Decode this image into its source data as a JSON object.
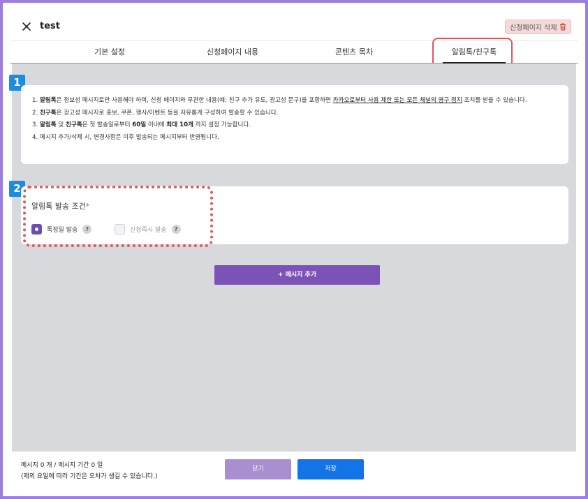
{
  "header": {
    "title": "test",
    "delete_label": "신청페이지 삭제"
  },
  "tabs": [
    {
      "label": "기본 설정"
    },
    {
      "label": "신청페이지 내용"
    },
    {
      "label": "콘텐츠 목차"
    },
    {
      "label": "알림톡/친구톡",
      "active": true
    }
  ],
  "badges": [
    "1",
    "2"
  ],
  "notice": {
    "l1_b1": "알림톡",
    "l1_t1": "은 정보성 메시지로만 사용해야 하며, 신청 페이지와 무관한 내용(예: 친구 추가 유도, 광고성 문구)을 포함하면 ",
    "l1_u": "카카오로부터 사용 제한 또는 모든 채널의 영구 정지",
    "l1_t2": " 조치를 받을 수 있습니다.",
    "l2_b1": "친구톡",
    "l2_t1": "은 광고성 메시지로 홍보, 쿠폰, 행사/이벤트 등을 자유롭게 구성하여 발송할 수 있습니다.",
    "l3_b1": "알림톡",
    "l3_t1": " 및 ",
    "l3_b2": "친구톡",
    "l3_t2": "은 첫 발송일로부터 ",
    "l3_b3": "60일",
    "l3_t3": " 이내에 ",
    "l3_b4": "최대 10개",
    "l3_t4": " 까지 설정 가능합니다.",
    "l4_t1": "메시지 추가/삭제 시, 변경사항은 이후 발송되는 메시지부터 반영됩니다."
  },
  "condition": {
    "label": "알림톡 발송 조건",
    "required_mark": "*",
    "options": [
      {
        "label": "특정일 발송",
        "checked": true
      },
      {
        "label": "신청즉시 발송",
        "checked": false
      }
    ],
    "help": "?"
  },
  "add_button": "+ 메시지 추가",
  "footer": {
    "info_line1": "메시지 0 개 / 메시지 기간 0 일",
    "info_line2": "(제외 요일에 따라 기간은 오차가 생길 수 있습니다.)",
    "close_label": "닫기",
    "save_label": "저장"
  },
  "colors": {
    "accent": "#7b52b6",
    "primary": "#1473e6",
    "highlight": "#e0565b",
    "badge": "#1e8be0"
  }
}
